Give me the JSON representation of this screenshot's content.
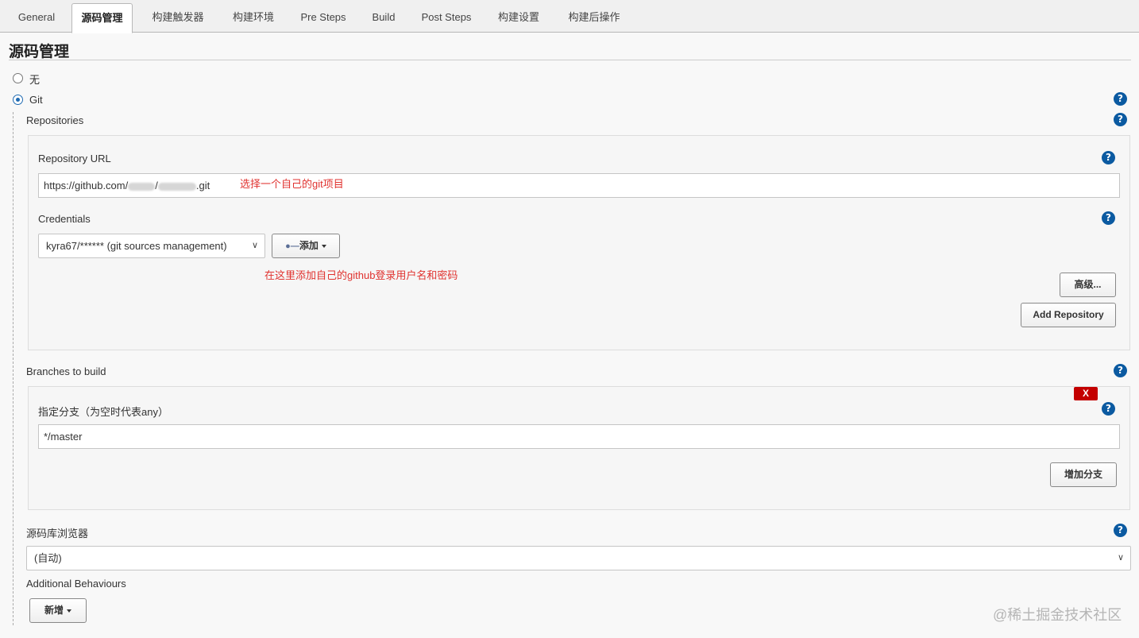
{
  "tabs": [
    {
      "label": "General",
      "active": false
    },
    {
      "label": "源码管理",
      "active": true
    },
    {
      "label": "构建触发器",
      "active": false
    },
    {
      "label": "构建环境",
      "active": false
    },
    {
      "label": "Pre Steps",
      "active": false
    },
    {
      "label": "Build",
      "active": false
    },
    {
      "label": "Post Steps",
      "active": false
    },
    {
      "label": "构建设置",
      "active": false
    },
    {
      "label": "构建后操作",
      "active": false
    }
  ],
  "section": {
    "title": "源码管理"
  },
  "scm": {
    "option_none": "无",
    "option_git": "Git",
    "selected": "Git"
  },
  "repositories": {
    "label": "Repositories",
    "url_label": "Repository URL",
    "url_prefix": "https://github.com/",
    "url_suffix": ".git",
    "url_annotation": "选择一个自己的git项目",
    "credentials_label": "Credentials",
    "credentials_value": "kyra67/****** (git sources management)",
    "add_button": "添加",
    "credentials_annotation": "在这里添加自己的github登录用户名和密码",
    "advanced_button": "高级...",
    "add_repository_button": "Add Repository"
  },
  "branches": {
    "label": "Branches to build",
    "delete_label": "X",
    "specifier_label": "指定分支（为空时代表any）",
    "specifier_value": "*/master",
    "add_branch_button": "增加分支"
  },
  "browser": {
    "label": "源码库浏览器",
    "value": "(自动)"
  },
  "behaviours": {
    "label": "Additional Behaviours",
    "add_button": "新增"
  },
  "help_icon_glyph": "?",
  "watermark": "@稀土掘金技术社区",
  "colors": {
    "accent_blue": "#0b5aa1",
    "annotation_red": "#e0322f",
    "delete_red": "#c40000"
  }
}
